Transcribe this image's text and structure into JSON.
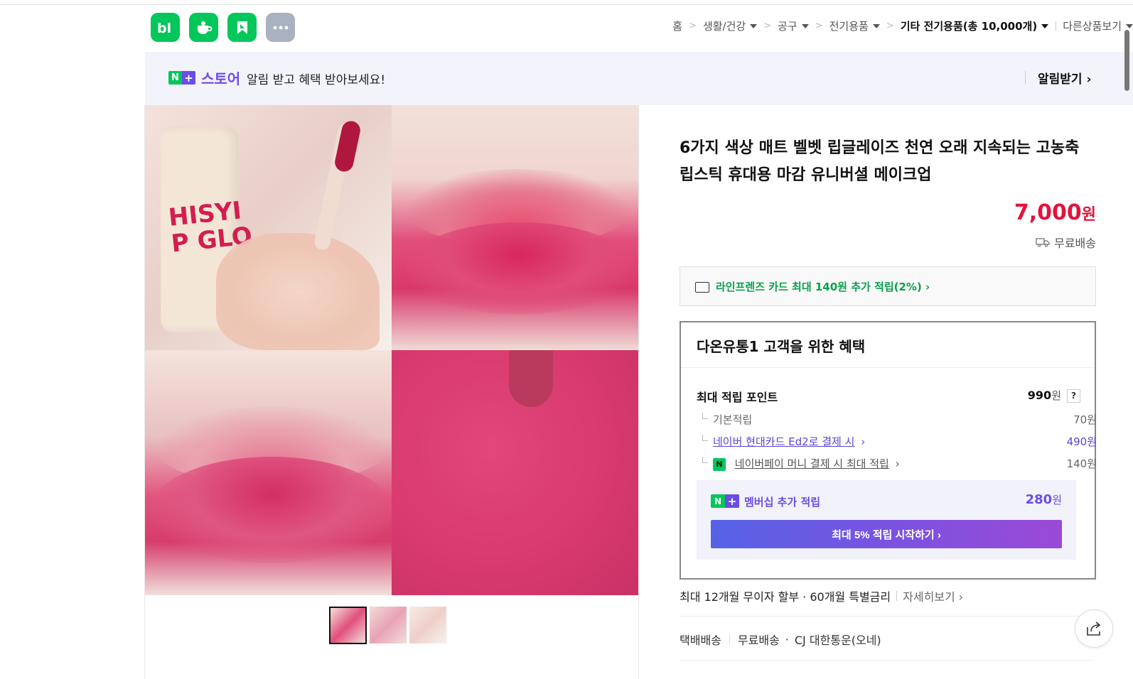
{
  "header": {
    "apps": [
      {
        "name": "blog-app-icon",
        "glyph": "b|"
      },
      {
        "name": "cafe-app-icon",
        "glyph": "☕"
      },
      {
        "name": "bookmark-app-icon",
        "glyph": "⚑"
      },
      {
        "name": "more-apps-icon",
        "glyph": "•••"
      }
    ],
    "breadcrumb": {
      "home": "홈",
      "cat1": "생활/건강",
      "cat2": "공구",
      "cat3": "전기용품",
      "cat4": "기타 전기용품(총 10,000개)",
      "other": "다른상품보기"
    }
  },
  "banner": {
    "n": "N",
    "plus": "+",
    "store": "스토어",
    "text": "알림 받고 혜택 받아보세요!",
    "action": "알림받기 ›"
  },
  "gallery": {
    "bottle_text": "HISYI\nP GLO"
  },
  "product": {
    "title": "6가지 색상 매트 벨벳 립글레이즈 천연 오래 지속되는 고농축 립스틱 휴대용 마감 유니버셜 메이크업",
    "price": "7,000",
    "price_unit": "원",
    "shipping": "무료배송"
  },
  "card_offer": "라인프렌즈 카드 최대 140원 추가 적립(2%) ›",
  "benefit": {
    "title": "다온유통1 고객을 위한 혜택",
    "max_points_label": "최대 적립 포인트",
    "max_points_value": "990",
    "unit": "원",
    "help": "?",
    "base_label": "기본적립",
    "base_value": "70원",
    "hyundai_label": "네이버 현대카드 Ed2로 결제 시",
    "hyundai_value": "490원",
    "npay_label": "네이버페이 머니 결제 시 최대 적립",
    "npay_value": "140원",
    "chevron": "›",
    "membership_label": "멤버십 추가 적립",
    "membership_value": "280",
    "membership_button": "최대 5% 적립 시작하기 ›"
  },
  "installment": {
    "text": "최대 12개월 무이자 할부 · 60개월 특별금리",
    "more": "자세히보기 ›"
  },
  "delivery": {
    "type": "택배배송",
    "fee": "무료배송",
    "dot": "·",
    "carrier": "CJ 대한통운(오네)"
  },
  "colors": {
    "naver_green": "#03c75a",
    "nplus_purple": "#6c4ce8",
    "price_red": "#e2143c"
  }
}
